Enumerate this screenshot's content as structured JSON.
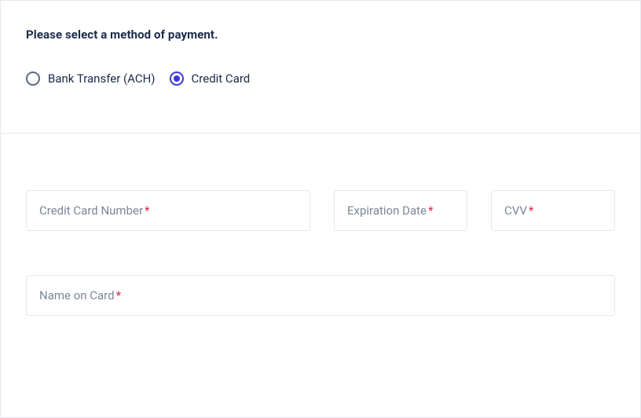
{
  "heading": "Please select a method of payment.",
  "payment_methods": {
    "bank_transfer": {
      "label": "Bank Transfer (ACH)",
      "selected": false
    },
    "credit_card": {
      "label": "Credit Card",
      "selected": true
    }
  },
  "fields": {
    "cc_number": {
      "label": "Credit Card Number",
      "required_marker": "*",
      "value": ""
    },
    "expiration": {
      "label": "Expiration Date",
      "required_marker": "*",
      "value": ""
    },
    "cvv": {
      "label": "CVV",
      "required_marker": "*",
      "value": ""
    },
    "name_on_card": {
      "label": "Name on Card",
      "required_marker": "*",
      "value": ""
    }
  }
}
